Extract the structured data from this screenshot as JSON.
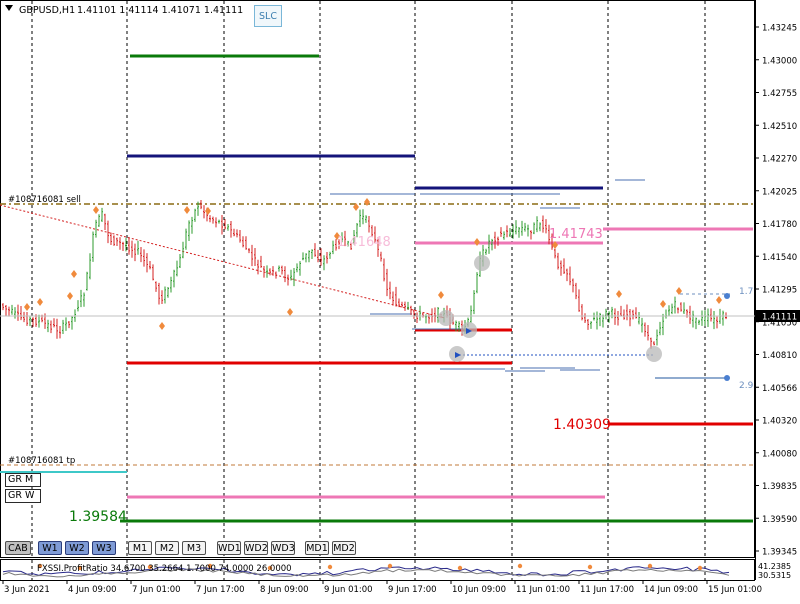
{
  "header": {
    "symbol_timeframe": "GBPUSD,H1",
    "ohlc": "1.41101 1.41114 1.41071 1.41111"
  },
  "slc_button": "SLC",
  "order_labels": {
    "sell": "#108716081 sell",
    "tp": "#108716081 tp"
  },
  "price_labels": {
    "upper_pink": "1.41743",
    "upper_pink_faded": "1.41648",
    "red_right": "1.40309",
    "green_left": "1.39584",
    "blue_1": "1.7",
    "blue_2": "2.9"
  },
  "price_axis": {
    "ticks": [
      "1.43245",
      "1.43000",
      "1.42755",
      "1.42510",
      "1.42270",
      "1.42025",
      "1.41780",
      "1.41540",
      "1.41295",
      "1.41050",
      "1.40810",
      "1.40566",
      "1.40320",
      "1.40080",
      "1.39835",
      "1.39590",
      "1.39345"
    ],
    "current_price": "1.41111",
    "sub_ticks": [
      "41.2385",
      "30.5315"
    ]
  },
  "time_axis": {
    "labels": [
      "3 Jun 2021",
      "4 Jun 09:00",
      "7 Jun 01:00",
      "7 Jun 17:00",
      "8 Jun 09:00",
      "9 Jun 01:00",
      "9 Jun 17:00",
      "10 Jun 09:00",
      "11 Jun 01:00",
      "11 Jun 17:00",
      "14 Jun 09:00",
      "15 Jun 01:00"
    ]
  },
  "indicator": {
    "label": "FXSSI.ProfitRatio 34.6700 35.2664 1.7000 74.0000 26.0000"
  },
  "gr_buttons": [
    "GR M",
    "GR W"
  ],
  "timeframe_buttons": {
    "group1": [
      "CAB",
      "W1",
      "W2",
      "W3"
    ],
    "group2": [
      "M1",
      "M2",
      "M3"
    ],
    "group3": [
      "WD1",
      "WD2",
      "WD3"
    ],
    "group4": [
      "MD1",
      "MD2"
    ]
  },
  "colors": {
    "bull": "#2e9b2e",
    "bear": "#d42020",
    "green_level": "#0a7a0a",
    "navy_level": "#14147a",
    "red_level": "#e00000",
    "pink_level": "#ee77b5",
    "blue_dash": "#2050c0",
    "orange_marker": "#f08a3c"
  },
  "chart_data": {
    "type": "candlestick",
    "symbol": "GBPUSD",
    "timeframe": "H1",
    "open": 1.41101,
    "high": 1.41114,
    "low": 1.41071,
    "close": 1.41111,
    "ylim": [
      1.3934,
      1.4337
    ],
    "levels": [
      1.4303,
      1.423,
      1.421,
      1.417,
      1.4165,
      1.4105,
      1.4077,
      1.40309,
      1.3995,
      1.39584
    ]
  }
}
